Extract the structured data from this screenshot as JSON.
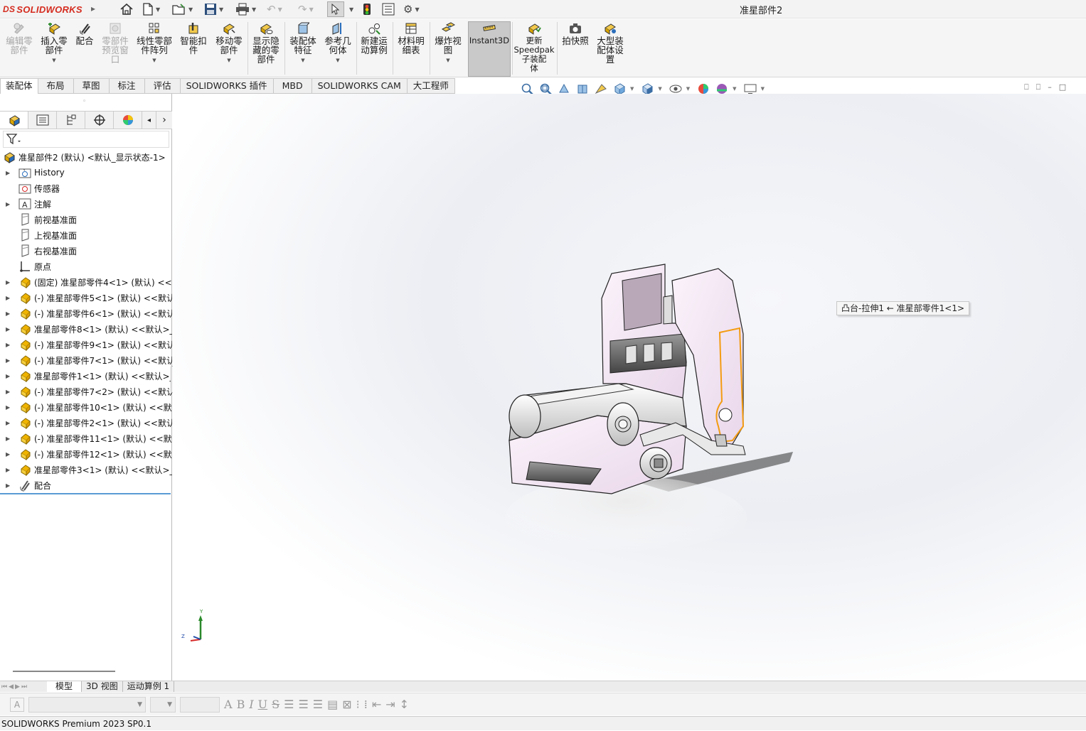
{
  "app": {
    "logo_ds": "DS",
    "logo_text": "SOLIDWORKS",
    "window_title": "准星部件2"
  },
  "ribbon": [
    {
      "label": "编辑零\n部件",
      "enabled": false,
      "icon": "edit-part-icon"
    },
    {
      "label": "插入零\n部件",
      "enabled": true,
      "icon": "insert-component-icon"
    },
    {
      "label": "配合",
      "enabled": true,
      "icon": "mate-icon"
    },
    {
      "label": "零部件\n预览窗\n口",
      "enabled": false,
      "icon": "component-preview-icon"
    },
    {
      "label": "线性零部\n件阵列",
      "enabled": true,
      "icon": "linear-pattern-icon"
    },
    {
      "label": "智能扣\n件",
      "enabled": true,
      "icon": "smart-fastener-icon"
    },
    {
      "label": "移动零\n部件",
      "enabled": true,
      "icon": "move-component-icon"
    },
    {
      "label": "显示隐\n藏的零\n部件",
      "enabled": true,
      "icon": "show-hidden-icon"
    },
    {
      "label": "装配体\n特征",
      "enabled": true,
      "icon": "assembly-feature-icon"
    },
    {
      "label": "参考几\n何体",
      "enabled": true,
      "icon": "reference-geometry-icon"
    },
    {
      "label": "新建运\n动算例",
      "enabled": true,
      "icon": "motion-study-icon"
    },
    {
      "label": "材料明\n细表",
      "enabled": true,
      "icon": "bom-icon"
    },
    {
      "label": "爆炸视\n图",
      "enabled": true,
      "icon": "exploded-view-icon"
    },
    {
      "label": "Instant3D",
      "enabled": true,
      "icon": "instant3d-icon"
    },
    {
      "label": "更新\nSpeedpak\n子装配\n体",
      "enabled": true,
      "icon": "speedpak-icon"
    },
    {
      "label": "拍快照",
      "enabled": true,
      "icon": "snapshot-icon"
    },
    {
      "label": "大型装\n配体设\n置",
      "enabled": true,
      "icon": "large-assembly-icon"
    }
  ],
  "tabs": [
    "装配体",
    "布局",
    "草图",
    "标注",
    "评估",
    "SOLIDWORKS 插件",
    "MBD",
    "SOLIDWORKS CAM",
    "大工程师"
  ],
  "tree": {
    "root": "准星部件2 (默认) <默认_显示状态-1>",
    "items": [
      {
        "label": "History",
        "icon": "history-folder-icon",
        "expand": true
      },
      {
        "label": "传感器",
        "icon": "sensor-icon",
        "expand": false
      },
      {
        "label": "注解",
        "icon": "annotation-icon",
        "expand": true
      },
      {
        "label": "前视基准面",
        "icon": "plane-icon",
        "expand": false
      },
      {
        "label": "上视基准面",
        "icon": "plane-icon",
        "expand": false
      },
      {
        "label": "右视基准面",
        "icon": "plane-icon",
        "expand": false
      },
      {
        "label": "原点",
        "icon": "origin-icon",
        "expand": false
      },
      {
        "label": "(固定) 准星部零件4<1> (默认) <<默",
        "icon": "part-icon",
        "expand": true
      },
      {
        "label": "(-) 准星部零件5<1> (默认) <<默认",
        "icon": "part-icon",
        "expand": true
      },
      {
        "label": "(-) 准星部零件6<1> (默认) <<默认",
        "icon": "part-icon",
        "expand": true
      },
      {
        "label": "准星部零件8<1> (默认) <<默认>_显",
        "icon": "part-icon",
        "expand": true
      },
      {
        "label": "(-) 准星部零件9<1> (默认) <<默认",
        "icon": "part-icon",
        "expand": true
      },
      {
        "label": "(-) 准星部零件7<1> (默认) <<默认",
        "icon": "part-icon",
        "expand": true
      },
      {
        "label": "准星部零件1<1> (默认) <<默认>_显",
        "icon": "part-icon",
        "expand": true
      },
      {
        "label": "(-) 准星部零件7<2> (默认) <<默认",
        "icon": "part-icon",
        "expand": true
      },
      {
        "label": "(-) 准星部零件10<1> (默认) <<默认",
        "icon": "part-icon",
        "expand": true
      },
      {
        "label": "(-) 准星部零件2<1> (默认) <<默认",
        "icon": "part-icon",
        "expand": true
      },
      {
        "label": "(-) 准星部零件11<1> (默认) <<默认",
        "icon": "part-icon",
        "expand": true
      },
      {
        "label": "(-) 准星部零件12<1> (默认) <<默认",
        "icon": "part-icon",
        "expand": true
      },
      {
        "label": "准星部零件3<1> (默认) <<默认>_显",
        "icon": "part-icon",
        "expand": true
      },
      {
        "label": "配合",
        "icon": "mates-folder-icon",
        "expand": true
      }
    ]
  },
  "viewport": {
    "tooltip": "凸台-拉伸1 ← 准星部零件1<1>",
    "triad": {
      "y": "Y",
      "z": "Z"
    }
  },
  "bottom_tabs": [
    "模型",
    "3D 视图",
    "运动算例 1"
  ],
  "status": "SOLIDWORKS Premium 2023 SP0.1",
  "colors": {
    "brand": "#d52b1e",
    "highlight": "#f39c12",
    "part_icon": "#f0b400",
    "selection": "#5b9bd5"
  }
}
